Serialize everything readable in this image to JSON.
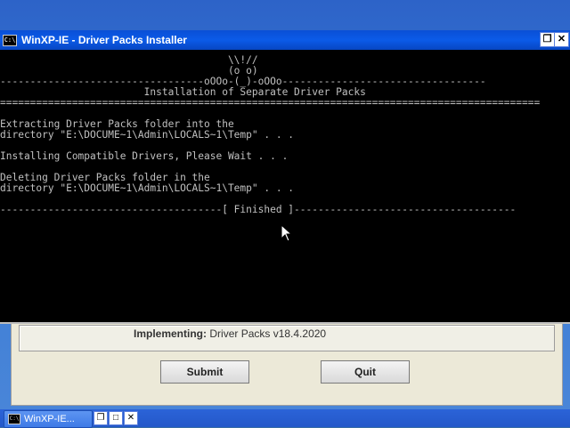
{
  "window": {
    "title": "WinXP-IE - Driver Packs Installer",
    "icon_label": "C:\\",
    "controls": {
      "restore": "❐",
      "close": "✕"
    }
  },
  "console_lines": [
    "                                      \\\\!//",
    "                                      (o o)",
    "----------------------------------oOOo-(_)-oOOo----------------------------------",
    "                        Installation of Separate Driver Packs",
    "==========================================================================================",
    "",
    "Extracting Driver Packs folder into the",
    "directory \"E:\\DOCUME~1\\Admin\\LOCALS~1\\Temp\" . . .",
    "",
    "Installing Compatible Drivers, Please Wait . . .",
    "",
    "Deleting Driver Packs folder in the",
    "directory \"E:\\DOCUME~1\\Admin\\LOCALS~1\\Temp\" . . .",
    "",
    "-------------------------------------[ Finished ]-------------------------------------"
  ],
  "background_window": {
    "implementing_label": "Implementing:",
    "implementing_value": "Driver Packs v18.4.2020",
    "submit_label": "Submit",
    "quit_label": "Quit"
  },
  "taskbar": {
    "task_label": "WinXP-IE...",
    "icon_label": "C:\\",
    "controls": {
      "restore": "❐",
      "maximize": "□",
      "close": "✕"
    }
  },
  "icons": {
    "app": "console-icon",
    "cursor": "mouse-pointer-icon"
  }
}
